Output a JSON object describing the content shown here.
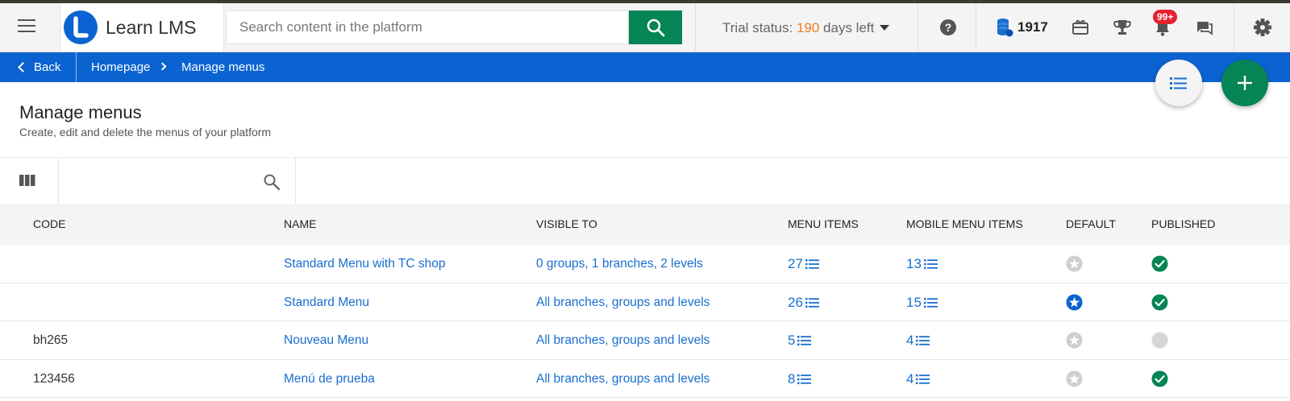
{
  "app": {
    "name": "Learn LMS",
    "search_placeholder": "Search content in the platform"
  },
  "header": {
    "trial_label": "Trial status: ",
    "trial_days": "190",
    "trial_suffix": " days left",
    "credits": "1917",
    "notifications_badge": "99+"
  },
  "breadcrumb": {
    "back_label": "Back",
    "home_label": "Homepage",
    "current_label": "Manage menus"
  },
  "page": {
    "title": "Manage menus",
    "subtitle": "Create, edit and delete the menus of your platform"
  },
  "table": {
    "columns": [
      "CODE",
      "NAME",
      "VISIBLE TO",
      "MENU ITEMS",
      "MOBILE MENU ITEMS",
      "DEFAULT",
      "PUBLISHED"
    ],
    "rows": [
      {
        "code": "",
        "name": "Standard Menu with TC shop",
        "visible_to": "0 groups, 1 branches, 2 levels",
        "menu_items": "27",
        "mobile_menu_items": "13",
        "default": false,
        "published": true
      },
      {
        "code": "",
        "name": "Standard Menu",
        "visible_to": "All branches, groups and levels",
        "menu_items": "26",
        "mobile_menu_items": "15",
        "default": true,
        "published": true
      },
      {
        "code": "bh265",
        "name": "Nouveau Menu",
        "visible_to": "All branches, groups and levels",
        "menu_items": "5",
        "mobile_menu_items": "4",
        "default": false,
        "published": false
      },
      {
        "code": "123456",
        "name": "Menú de prueba",
        "visible_to": "All branches, groups and levels",
        "menu_items": "8",
        "mobile_menu_items": "4",
        "default": false,
        "published": true
      }
    ]
  },
  "colors": {
    "brand_blue": "#0b63d1",
    "brand_green": "#058455",
    "link_blue": "#1a6ecf",
    "trial_orange": "#f07b1e",
    "badge_red": "#e5222f"
  }
}
